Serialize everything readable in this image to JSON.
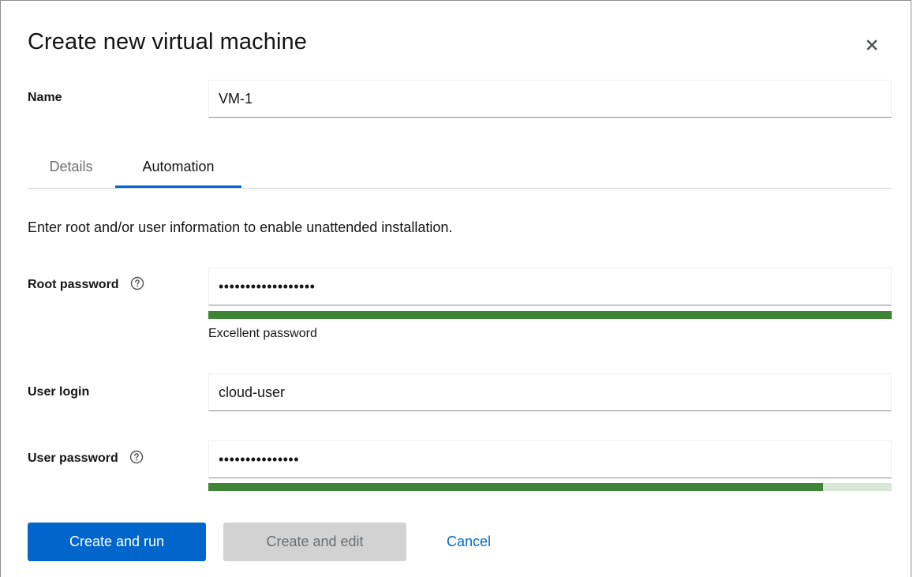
{
  "dialog": {
    "title": "Create new virtual machine",
    "close_label": "×"
  },
  "name_field": {
    "label": "Name",
    "value": "VM-1"
  },
  "tabs": [
    {
      "label": "Details",
      "active": false
    },
    {
      "label": "Automation",
      "active": true
    }
  ],
  "automation": {
    "description": "Enter root and/or user information to enable unattended installation.",
    "root_password": {
      "label": "Root password",
      "value": "••••••••••••••••••",
      "strength_text": "Excellent password",
      "strength_level": 1.0
    },
    "user_login": {
      "label": "User login",
      "value": "cloud-user"
    },
    "user_password": {
      "label": "User password",
      "value": "•••••••••••••••",
      "strength_level": 0.9
    }
  },
  "footer": {
    "create_and_run": "Create and run",
    "create_and_edit": "Create and edit",
    "cancel": "Cancel"
  },
  "colors": {
    "primary": "#0066cc",
    "success": "#3e8635",
    "success_track": "#d8e8d6",
    "disabled_bg": "#d2d2d2"
  },
  "icons": {
    "close": "close-icon",
    "help": "question-circle-icon"
  }
}
